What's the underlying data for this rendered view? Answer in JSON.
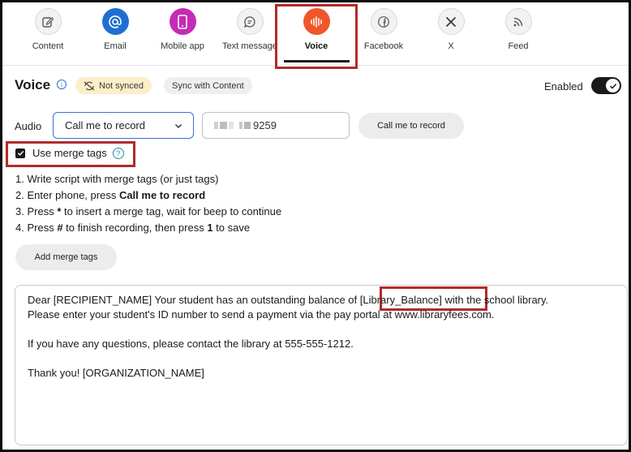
{
  "tabs": [
    {
      "label": "Content",
      "icon": "edit-icon",
      "active": false
    },
    {
      "label": "Email",
      "icon": "at-icon",
      "active": false
    },
    {
      "label": "Mobile app",
      "icon": "phone-icon",
      "active": false
    },
    {
      "label": "Text message",
      "icon": "chat-icon",
      "active": false
    },
    {
      "label": "Voice",
      "icon": "voice-wave-icon",
      "active": true
    },
    {
      "label": "Facebook",
      "icon": "facebook-icon",
      "active": false
    },
    {
      "label": "X",
      "icon": "x-icon",
      "active": false
    },
    {
      "label": "Feed",
      "icon": "rss-icon",
      "active": false
    }
  ],
  "header": {
    "title": "Voice",
    "status_badge": "Not synced",
    "sync_button": "Sync with Content",
    "enabled_label": "Enabled",
    "enabled": true
  },
  "audio": {
    "label": "Audio",
    "mode": "Call me to record",
    "phone_value": "9259",
    "record_button": "Call me to record"
  },
  "merge": {
    "checkbox_label": "Use merge tags",
    "checked": true,
    "steps": [
      {
        "n": "1.",
        "pre": "Write script with merge tags (or just tags)",
        "b": "",
        "post": ""
      },
      {
        "n": "2.",
        "pre": "Enter phone, press ",
        "b": "Call me to record",
        "post": ""
      },
      {
        "n": "3.",
        "pre": "Press ",
        "b": "*",
        "post": " to insert a merge tag, wait for beep to continue"
      },
      {
        "n": "4.",
        "pre": "Press ",
        "b": "#",
        "post": " to finish recording, then press ",
        "b2": "1",
        "post2": " to save"
      }
    ],
    "add_button": "Add merge tags"
  },
  "script": {
    "line1": "Dear [RECIPIENT_NAME] Your student has an outstanding balance of [Library_Balance] with the school library.",
    "line2": "Please enter your student's ID number to send a payment via the pay portal at www.libraryfees.com.",
    "line3": "If you have any questions, please contact the library at 555-555-1212.",
    "line4": "Thank you! [ORGANIZATION_NAME]"
  },
  "colors": {
    "highlight": "#b22a2a",
    "email": "#1f6fd1",
    "mobile": "#c52bb6",
    "voice": "#f0562b",
    "focus_border": "#3c6fd8"
  }
}
